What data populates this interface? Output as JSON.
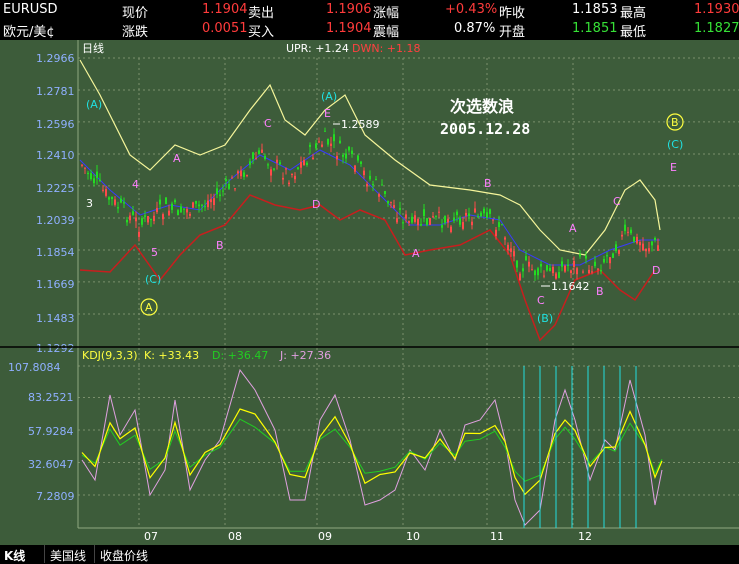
{
  "header": {
    "symbol": "EURUSD",
    "symbol_cn": "欧元/美¢",
    "row1": [
      {
        "label": "现价",
        "value": "1.1904"
      },
      {
        "label": "卖出",
        "value": "1.1906"
      },
      {
        "label": "涨幅",
        "value": "+0.43%"
      },
      {
        "label": "昨收",
        "value": "1.1853"
      },
      {
        "label": "最高",
        "value": "1.1930"
      }
    ],
    "row2": [
      {
        "label": "涨跌",
        "value": "0.0051"
      },
      {
        "label": "买入",
        "value": "1.1904"
      },
      {
        "label": "震幅",
        "value": "0.87%"
      },
      {
        "label": "开盘",
        "value": "1.1851"
      },
      {
        "label": "最低",
        "value": "1.1827"
      }
    ]
  },
  "main_panel": {
    "legend_period": "日线",
    "legend_upr": "UPR: +1.24",
    "legend_dwn": "DWN: +1.18",
    "y_ticks": [
      "1.2966",
      "1.2781",
      "1.2596",
      "1.2410",
      "1.2225",
      "1.2039",
      "1.1854",
      "1.1669",
      "1.1483",
      "1.1292"
    ],
    "title_line1": "次选数浪",
    "title_line2": "2005.12.28",
    "price_high_label": "1.2589",
    "price_low_label": "1.1642",
    "wave_labels": [
      {
        "text": "(A)",
        "color": "#20e0e0"
      },
      {
        "text": "3",
        "color": "#ffffff"
      },
      {
        "text": "4",
        "color": "#ff80ff"
      },
      {
        "text": "5",
        "color": "#ff80ff"
      },
      {
        "text": "(C)",
        "color": "#20e0e0"
      },
      {
        "text": "A",
        "color": "#ffff40"
      },
      {
        "text": "A",
        "color": "#ff80ff"
      },
      {
        "text": "B",
        "color": "#ff80ff"
      },
      {
        "text": "C",
        "color": "#ff80ff"
      },
      {
        "text": "D",
        "color": "#ff80ff"
      },
      {
        "text": "(A)",
        "color": "#20e0e0"
      },
      {
        "text": "E",
        "color": "#ff80ff"
      },
      {
        "text": "A",
        "color": "#ff80ff"
      },
      {
        "text": "B",
        "color": "#ff80ff"
      },
      {
        "text": "C",
        "color": "#ff80ff"
      },
      {
        "text": "(B)",
        "color": "#20e0e0"
      },
      {
        "text": "A",
        "color": "#ff80ff"
      },
      {
        "text": "B",
        "color": "#ff80ff"
      },
      {
        "text": "C",
        "color": "#ff80ff"
      },
      {
        "text": "D",
        "color": "#ff80ff"
      },
      {
        "text": "B",
        "color": "#ffff40"
      },
      {
        "text": "(C)",
        "color": "#20e0e0"
      },
      {
        "text": "E",
        "color": "#ff80ff"
      }
    ]
  },
  "kdj_panel": {
    "legend_name": "KDJ(9,3,3)",
    "legend_k": "K: +33.43",
    "legend_d": "D: +36.47",
    "legend_j": "J: +27.36",
    "y_ticks": [
      "107.8084",
      "83.2521",
      "57.9284",
      "32.6047",
      "7.2809"
    ]
  },
  "x_axis": {
    "months": [
      "07",
      "08",
      "09",
      "10",
      "11",
      "12"
    ]
  },
  "tabs": [
    {
      "label": "K线"
    },
    {
      "label": "美国线"
    },
    {
      "label": "收盘价线"
    }
  ],
  "colors": {
    "background": "#3d5c3a",
    "grid": "#7a8f6c",
    "upper_band": "#f5f59a",
    "lower_band": "#c81e1e",
    "middle_band": "#3a3aff",
    "up_candle": "#ff4a4a",
    "down_candle": "#22dd22",
    "k_line": "#ffff00",
    "d_line": "#22cc22",
    "j_line": "#e0a0e0",
    "marker": "#22dddd"
  },
  "chart_data": [
    {
      "type": "line",
      "title": "EURUSD 日线",
      "ylim": [
        1.1292,
        1.2966
      ],
      "x": [
        "07",
        "08",
        "09",
        "10",
        "11",
        "12"
      ],
      "series": [
        {
          "name": "UPR",
          "values": [
            1.28,
            1.245,
            1.225,
            1.28,
            1.265,
            1.23,
            1.215,
            1.2,
            1.215,
            1.215,
            1.195,
            1.209
          ]
        },
        {
          "name": "DWN",
          "values": [
            1.175,
            1.195,
            1.2,
            1.23,
            1.21,
            1.19,
            1.192,
            1.18,
            1.15,
            1.175,
            1.172,
            1.185
          ]
        }
      ],
      "high_mark": 1.2589,
      "low_mark": 1.1642
    },
    {
      "type": "line",
      "title": "KDJ(9,3,3)",
      "ylim": [
        7.2809,
        107.8084
      ],
      "series": [
        {
          "name": "K",
          "values": [
            33.43
          ]
        },
        {
          "name": "D",
          "values": [
            36.47
          ]
        },
        {
          "name": "J",
          "values": [
            27.36
          ]
        }
      ]
    }
  ]
}
